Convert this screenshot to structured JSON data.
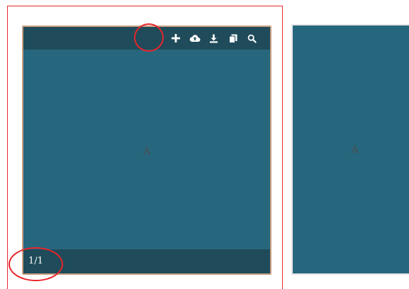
{
  "card_primary": {
    "content_label": "A",
    "page_counter": "1/1",
    "toolbar": {
      "add_icon": "plus-icon",
      "upload_icon": "cloud-upload-icon",
      "download_icon": "download-icon",
      "copy_icon": "copy-icon",
      "search_icon": "search-icon"
    }
  },
  "card_secondary": {
    "content_label": "A"
  },
  "colors": {
    "card_background": "#27677e",
    "toolbar_background": "#1f4b5a",
    "card_border": "#c9a184",
    "annotation": "#e8262a"
  }
}
